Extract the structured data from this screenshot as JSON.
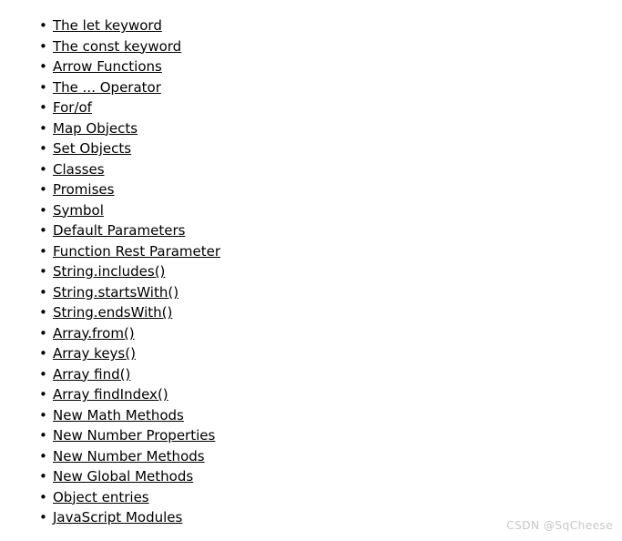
{
  "page": {
    "background_color": "#ffffff",
    "text_color": "#000000",
    "bullet_glyph": "•"
  },
  "list": {
    "items": [
      {
        "label": "The let keyword"
      },
      {
        "label": "The const keyword"
      },
      {
        "label": "Arrow Functions"
      },
      {
        "label": "The ... Operator"
      },
      {
        "label": "For/of"
      },
      {
        "label": "Map Objects"
      },
      {
        "label": "Set Objects"
      },
      {
        "label": "Classes"
      },
      {
        "label": "Promises"
      },
      {
        "label": "Symbol"
      },
      {
        "label": "Default Parameters"
      },
      {
        "label": "Function Rest Parameter"
      },
      {
        "label": "String.includes()"
      },
      {
        "label": "String.startsWith()"
      },
      {
        "label": "String.endsWith()"
      },
      {
        "label": "Array.from()"
      },
      {
        "label": "Array keys()"
      },
      {
        "label": "Array find()"
      },
      {
        "label": "Array findIndex()"
      },
      {
        "label": "New Math Methods"
      },
      {
        "label": "New Number Properties"
      },
      {
        "label": "New Number Methods"
      },
      {
        "label": "New Global Methods"
      },
      {
        "label": "Object entries"
      },
      {
        "label": "JavaScript Modules"
      }
    ]
  },
  "watermark": {
    "text": "CSDN @SqCheese",
    "color": "#c8c8c8"
  }
}
